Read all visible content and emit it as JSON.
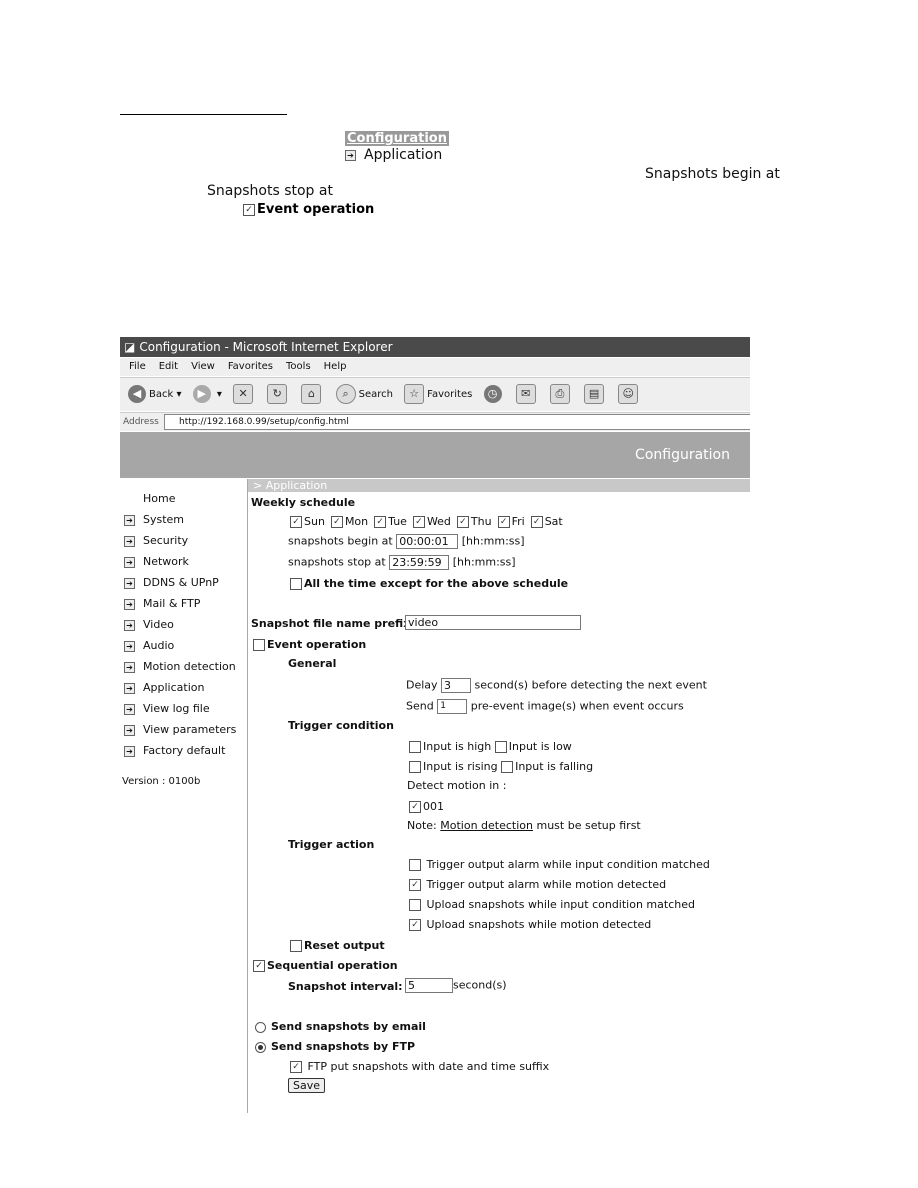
{
  "doc": {
    "config_tag": "Configuration",
    "application_label": "Application",
    "snap_begin": "Snapshots begin at",
    "snap_stop": "Snapshots stop at",
    "event_operation": "Event operation"
  },
  "browser": {
    "title": "Configuration - Microsoft Internet Explorer",
    "menu": [
      "File",
      "Edit",
      "View",
      "Favorites",
      "Tools",
      "Help"
    ],
    "toolbar": {
      "back": "Back",
      "search": "Search",
      "favorites": "Favorites"
    },
    "address_label": "Address",
    "address": "http://192.168.0.99/setup/config.html"
  },
  "app": {
    "header_title": "Configuration",
    "breadcrumb": "> Application",
    "sidebar": {
      "home": "Home",
      "items": [
        "System",
        "Security",
        "Network",
        "DDNS & UPnP",
        "Mail & FTP",
        "Video",
        "Audio",
        "Motion detection",
        "Application",
        "View log file",
        "View parameters",
        "Factory default"
      ],
      "version": "Version : 0100b"
    },
    "form": {
      "weekly_schedule": "Weekly schedule",
      "days": [
        {
          "label": "Sun",
          "checked": true
        },
        {
          "label": "Mon",
          "checked": true
        },
        {
          "label": "Tue",
          "checked": true
        },
        {
          "label": "Wed",
          "checked": true
        },
        {
          "label": "Thu",
          "checked": true
        },
        {
          "label": "Fri",
          "checked": true
        },
        {
          "label": "Sat",
          "checked": true
        }
      ],
      "begin_label": "snapshots begin at",
      "begin_value": "00:00:01",
      "stop_label": "snapshots stop at",
      "stop_value": "23:59:59",
      "time_format": "[hh:mm:ss]",
      "all_time_except": "All the time except for the above schedule",
      "prefix_label": "Snapshot file name prefix",
      "prefix_value": "video",
      "event_operation": "Event operation",
      "general": "General",
      "delay_label": "Delay",
      "delay_value": "3",
      "delay_suffix": "second(s) before detecting the next event",
      "send_label": "Send",
      "send_value": "1",
      "send_suffix": "pre-event image(s) when event occurs",
      "trigger_condition": "Trigger condition",
      "input_high": "Input is high",
      "input_low": "Input is low",
      "input_rising": "Input is rising",
      "input_falling": "Input is falling",
      "detect_motion_in": "Detect motion in :",
      "motion_window": "001",
      "note_prefix": "Note:",
      "note_link": "Motion detection",
      "note_suffix": "must be setup first",
      "trigger_action": "Trigger action",
      "actions": [
        {
          "label": "Trigger output alarm while input condition matched",
          "checked": false
        },
        {
          "label": "Trigger output alarm while motion detected",
          "checked": true
        },
        {
          "label": "Upload snapshots while input condition matched",
          "checked": false
        },
        {
          "label": "Upload snapshots while motion detected",
          "checked": true
        }
      ],
      "reset_output": "Reset output",
      "sequential_operation": "Sequential operation",
      "interval_label": "Snapshot interval:",
      "interval_value": "5",
      "interval_suffix": "second(s)",
      "send_email": "Send snapshots by email",
      "send_ftp": "Send snapshots by FTP",
      "ftp_suffix": "FTP put snapshots with date and time suffix",
      "save": "Save"
    }
  }
}
